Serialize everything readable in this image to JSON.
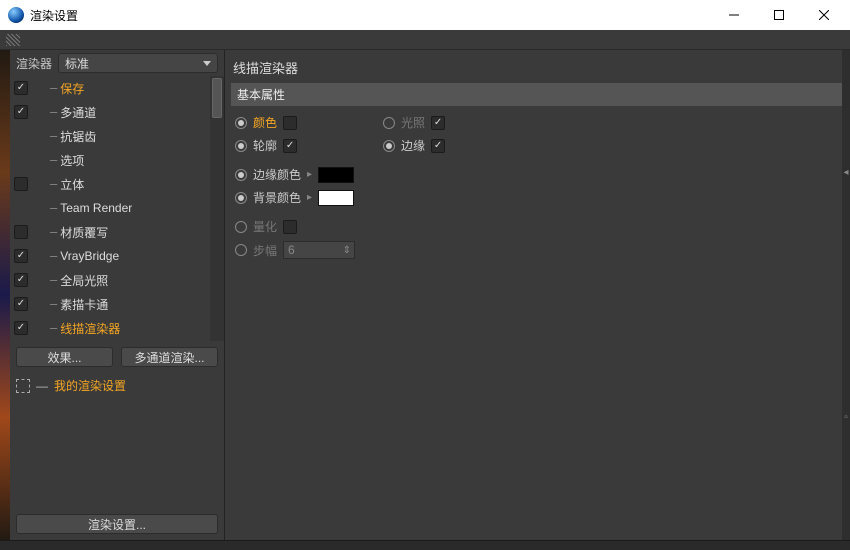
{
  "window": {
    "title": "渲染设置",
    "controls": {
      "min": "minimize",
      "max": "maximize",
      "close": "close"
    }
  },
  "sidebar": {
    "renderer_label": "渲染器",
    "renderer_value": "标准",
    "items": [
      {
        "label": "保存",
        "checked": true,
        "active": true
      },
      {
        "label": "多通道",
        "checked": true
      },
      {
        "label": "抗锯齿",
        "checked": null
      },
      {
        "label": "选项",
        "checked": null
      },
      {
        "label": "立体",
        "checked": false
      },
      {
        "label": "Team Render",
        "checked": null
      },
      {
        "label": "材质覆写",
        "checked": false
      },
      {
        "label": "VrayBridge",
        "checked": true
      },
      {
        "label": "全局光照",
        "checked": true
      },
      {
        "label": "素描卡通",
        "checked": true
      },
      {
        "label": "线描渲染器",
        "checked": true,
        "active": true
      }
    ],
    "effects_btn": "效果...",
    "multipass_btn": "多通道渲染...",
    "preset_label": "我的渲染设置",
    "render_settings_btn": "渲染设置..."
  },
  "main": {
    "title": "线描渲染器",
    "section": "基本属性",
    "props": {
      "color": "颜色",
      "illumination": "光照",
      "outline": "轮廓",
      "edges": "边缘",
      "edge_color": "边缘颜色",
      "bg_color": "背景颜色",
      "quantize": "量化",
      "step": "步幅",
      "step_value": "6"
    },
    "checks": {
      "color": false,
      "illumination": true,
      "outline": true,
      "edges": true,
      "quantize": false
    },
    "swatches": {
      "edge": "#000000",
      "bg": "#FFFFFF"
    }
  }
}
